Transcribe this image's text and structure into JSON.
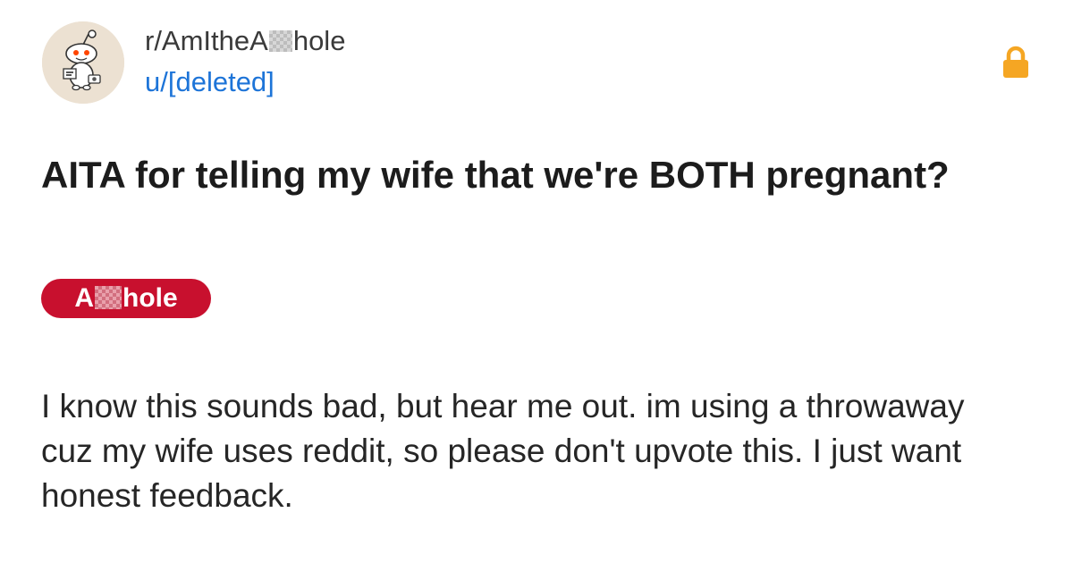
{
  "subreddit": {
    "name_start": "r/AmItheA",
    "name_censored_icon": "censor-pixel-block",
    "name_end": "hole"
  },
  "author": {
    "name": "u/[deleted]"
  },
  "lock": {
    "icon": "lock-icon",
    "color": "#f5a623"
  },
  "post": {
    "title": "AITA for telling my wife that we're BOTH pregnant?",
    "flair_start": "A",
    "flair_censored_icon": "censor-pixel-block",
    "flair_end": "hole",
    "flair_color": "#c8102e",
    "body": "I know this sounds bad, but hear me out. im using a throwaway cuz my wife uses reddit, so please don't upvote this. I just want honest feedback."
  },
  "colors": {
    "link_blue": "#1d74d8",
    "text": "#262626"
  }
}
